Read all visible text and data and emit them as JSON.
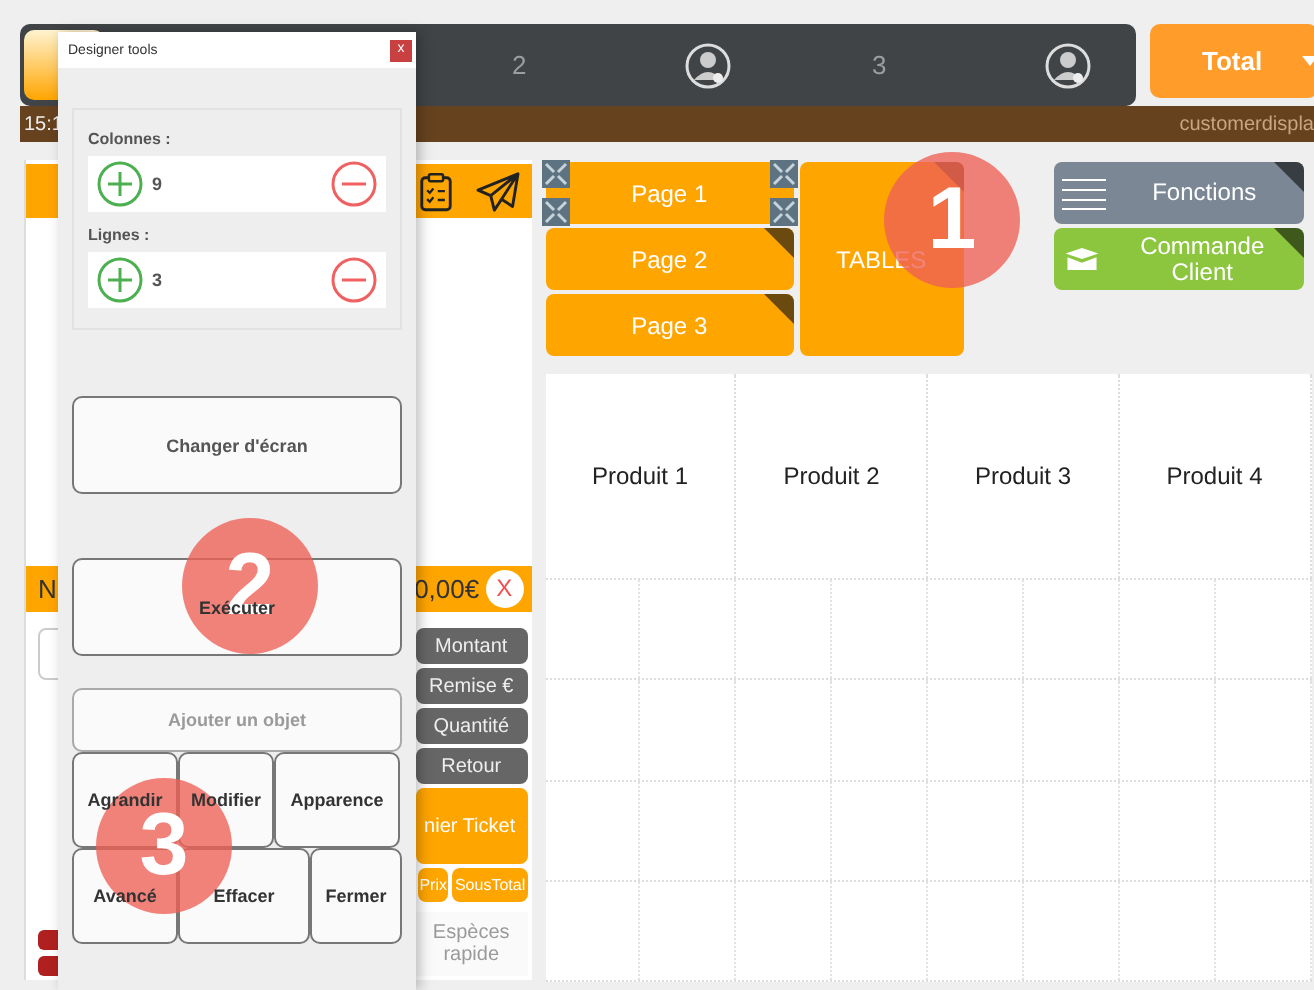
{
  "header": {
    "seats": [
      "2",
      "3"
    ],
    "total_button": "Total",
    "time": "15:1",
    "status_text": "customerdispla"
  },
  "order_panel": {
    "label": "N",
    "total": "0,00€",
    "clear_button": "X",
    "actions": [
      "Montant",
      "Remise €",
      "Quantité",
      "Retour"
    ],
    "ticket_button": "nier Ticket",
    "small_buttons": [
      "Prix",
      "SousTotal"
    ],
    "cash_button": {
      "label": "Espèces rapide",
      "disabled": true
    }
  },
  "pages": [
    {
      "label": "Page 1",
      "selected": true
    },
    {
      "label": "Page 2",
      "selected": false
    },
    {
      "label": "Page 3",
      "selected": false
    }
  ],
  "tables_button": "TABLES",
  "functions": [
    {
      "label": "Fonctions",
      "kind": "menu",
      "color": "#7b8794"
    },
    {
      "label": "Commande Client",
      "kind": "order",
      "color": "#8cc63f"
    }
  ],
  "products": [
    "Produit 1",
    "Produit 2",
    "Produit 3",
    "Produit 4"
  ],
  "designer": {
    "title": "Designer tools",
    "close": "x",
    "settings": [
      {
        "label": "Colonnes :",
        "value": "9"
      },
      {
        "label": "Lignes :",
        "value": "3"
      }
    ],
    "screen_button": "Changer d'écran",
    "run_button": "Exécuter",
    "add_button": {
      "label": "Ajouter un objet",
      "disabled": true
    },
    "tool_rows": [
      [
        "Agrandir",
        "Modifier",
        "Apparence"
      ],
      [
        "Avancé",
        "Effacer",
        "Fermer"
      ]
    ]
  },
  "callouts": [
    "1",
    "2",
    "3"
  ]
}
